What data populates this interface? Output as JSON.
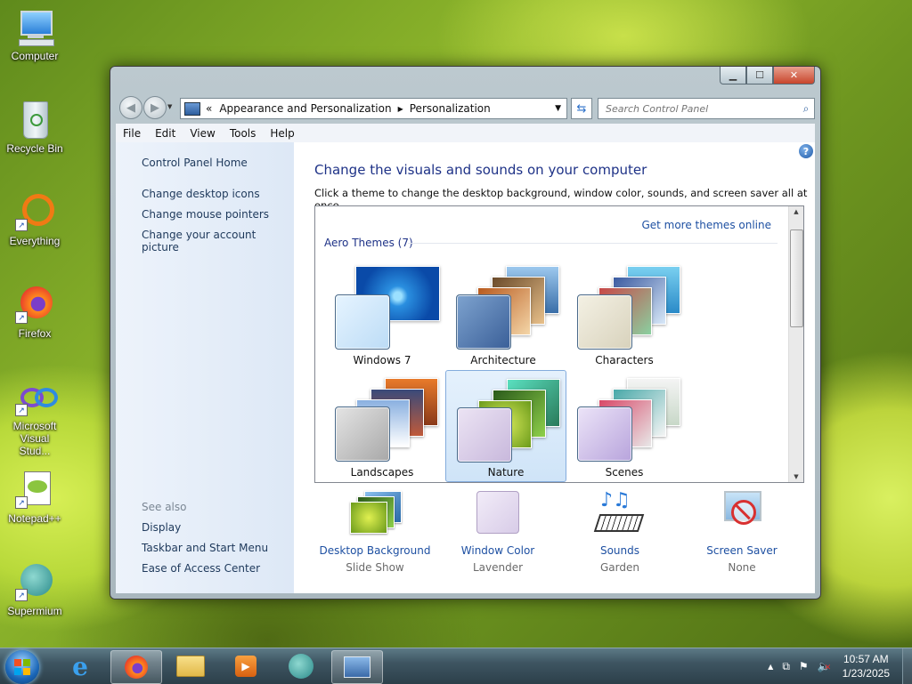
{
  "desktop": {
    "icons": [
      {
        "label": "Computer"
      },
      {
        "label": "Recycle Bin"
      },
      {
        "label": "Everything"
      },
      {
        "label": "Firefox"
      },
      {
        "label": "Microsoft Visual Stud..."
      },
      {
        "label": "Notepad++"
      },
      {
        "label": "Supermium"
      }
    ]
  },
  "window": {
    "address": {
      "prefix": "«",
      "crumbs": [
        "Appearance and Personalization",
        "Personalization"
      ]
    },
    "search_placeholder": "Search Control Panel",
    "menu": [
      "File",
      "Edit",
      "View",
      "Tools",
      "Help"
    ],
    "left_pane": {
      "home": "Control Panel Home",
      "links": [
        "Change desktop icons",
        "Change mouse pointers",
        "Change your account picture"
      ],
      "see_also_label": "See also",
      "see_also": [
        "Display",
        "Taskbar and Start Menu",
        "Ease of Access Center"
      ]
    },
    "heading": "Change the visuals and sounds on your computer",
    "subtext": "Click a theme to change the desktop background, window color, sounds, and screen saver all at once.",
    "get_more": "Get more themes online",
    "section": "Aero Themes (7)",
    "themes": [
      {
        "name": "Windows 7",
        "selected": false
      },
      {
        "name": "Architecture",
        "selected": false
      },
      {
        "name": "Characters",
        "selected": false
      },
      {
        "name": "Landscapes",
        "selected": false
      },
      {
        "name": "Nature",
        "selected": true
      },
      {
        "name": "Scenes",
        "selected": false
      }
    ],
    "bottom": [
      {
        "label": "Desktop Background",
        "value": "Slide Show"
      },
      {
        "label": "Window Color",
        "value": "Lavender"
      },
      {
        "label": "Sounds",
        "value": "Garden"
      },
      {
        "label": "Screen Saver",
        "value": "None"
      }
    ]
  },
  "taskbar": {
    "time": "10:57 AM",
    "date": "1/23/2025",
    "tray_arrow": "▲"
  }
}
